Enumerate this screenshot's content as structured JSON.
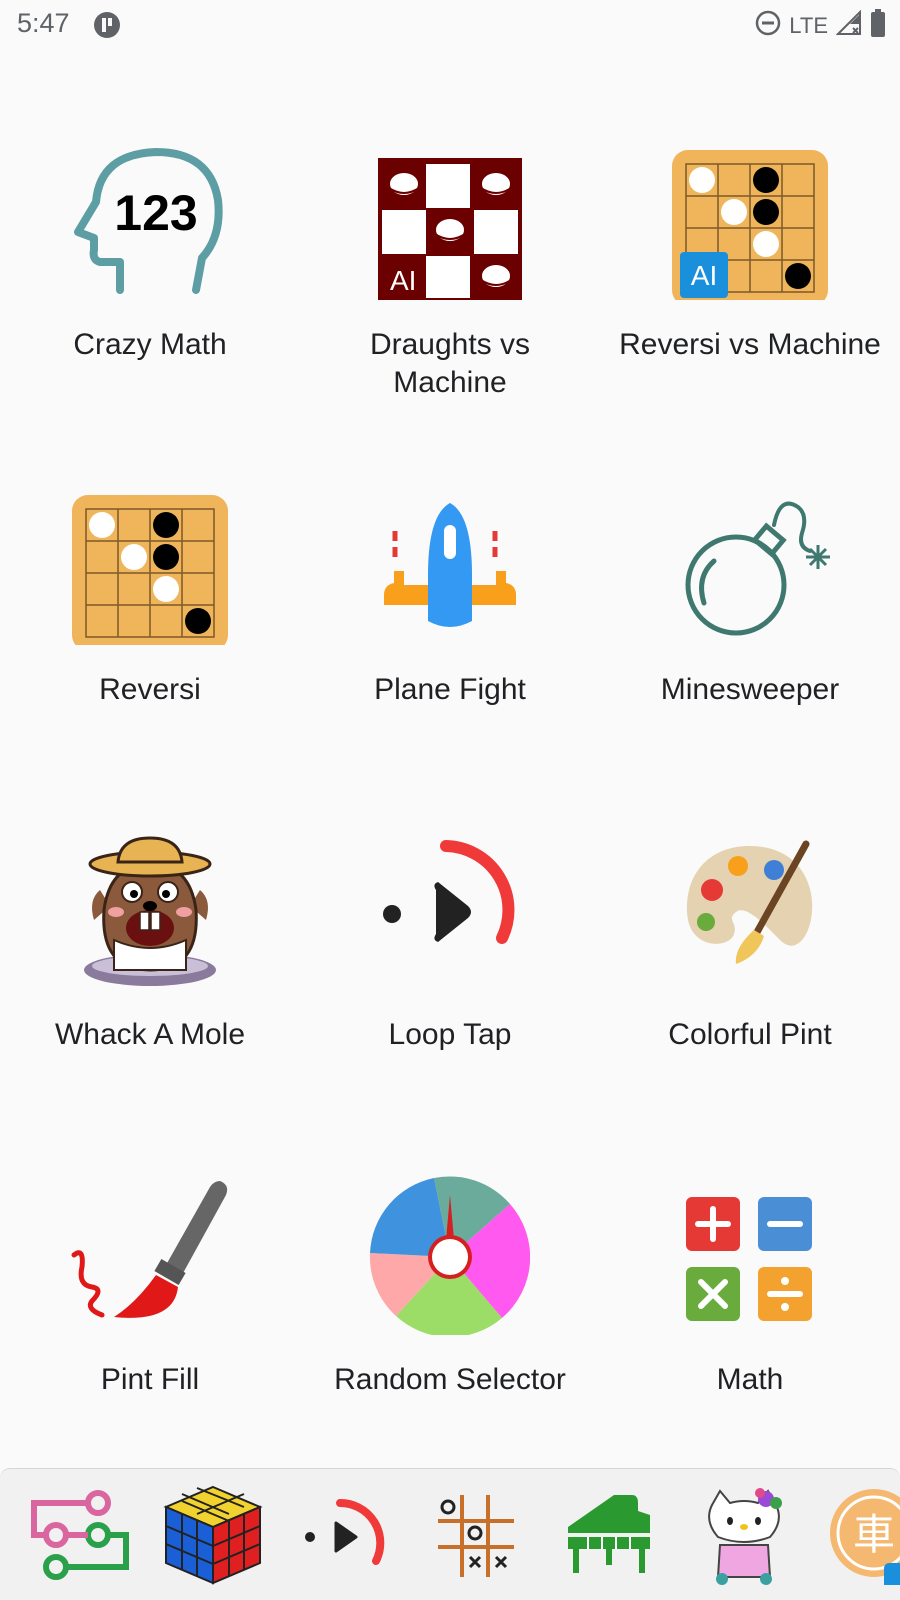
{
  "status_bar": {
    "time": "5:47",
    "network": "LTE",
    "icons": [
      "notification-app-icon",
      "do-not-disturb-icon",
      "signal-icon",
      "battery-icon"
    ]
  },
  "apps": [
    {
      "label": "Crazy Math",
      "icon": "head-123-icon",
      "icon_text": "123"
    },
    {
      "label": "Draughts vs Machine",
      "icon": "draughts-board-icon",
      "icon_text": "AI"
    },
    {
      "label": "Reversi vs Machine",
      "icon": "reversi-ai-board-icon",
      "icon_text": "AI"
    },
    {
      "label": "Reversi",
      "icon": "reversi-board-icon"
    },
    {
      "label": "Plane Fight",
      "icon": "plane-icon"
    },
    {
      "label": "Minesweeper",
      "icon": "bomb-icon"
    },
    {
      "label": "Whack A Mole",
      "icon": "mole-icon"
    },
    {
      "label": "Loop Tap",
      "icon": "loop-tap-icon"
    },
    {
      "label": "Colorful Pint",
      "icon": "paint-palette-icon"
    },
    {
      "label": "Pint Fill",
      "icon": "paintbrush-icon"
    },
    {
      "label": "Random Selector",
      "icon": "spinner-wheel-icon"
    },
    {
      "label": "Math",
      "icon": "math-operators-icon"
    }
  ],
  "dock": {
    "items": [
      {
        "icon": "flowchart-icon"
      },
      {
        "icon": "rubiks-cube-icon"
      },
      {
        "icon": "loop-tap-icon"
      },
      {
        "icon": "tic-tac-toe-icon"
      },
      {
        "icon": "piano-icon"
      },
      {
        "icon": "hello-kitty-icon"
      },
      {
        "icon": "chinese-chess-icon",
        "icon_text": "車"
      }
    ]
  },
  "colors": {
    "background": "#fafafa",
    "label_text": "#202124",
    "reversi_board": "#f0b45b",
    "draughts_dark": "#6b0000",
    "ai_badge": "#1a8fdc",
    "crazy_math_teal": "#5d9ea4",
    "loop_red": "#f03a3a",
    "plane_blue": "#3399f3",
    "plane_orange": "#f8a01c",
    "bomb_green": "#3f786f",
    "math_red": "#e53935",
    "math_blue": "#4a8fd6",
    "math_green": "#6aab3d",
    "math_orange": "#f3a12f"
  }
}
